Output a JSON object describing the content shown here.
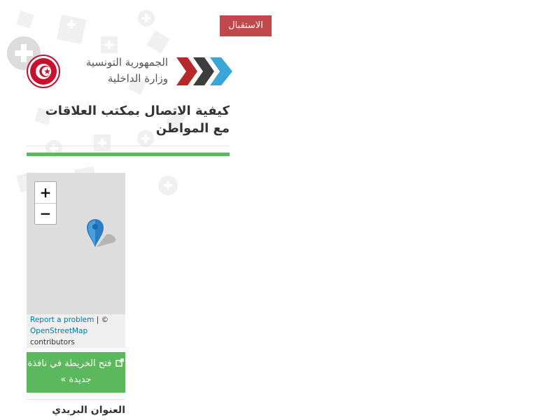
{
  "nav": {
    "home_label": "الاستقبال"
  },
  "header": {
    "ministry_line1": "الجمهورية التونسية",
    "ministry_line2": "وزارة الداخلية",
    "brand_colors": {
      "chevron_red": "#b5282b",
      "chevron_dark": "#3d3d3d",
      "chevron_blue": "#3aa6d8",
      "emblem_red": "#c8102e"
    }
  },
  "page": {
    "title": "كيفية الاتصال بمكتب العلاقات مع المواطن",
    "accent_color": "#5cb85c"
  },
  "map": {
    "zoom_in_label": "+",
    "zoom_out_label": "−",
    "marker_icon": "map-marker-icon",
    "attribution": {
      "report_link": "Report a problem",
      "separator": " | © ",
      "osm_link": "OpenStreetMap",
      "contributors": "contributors"
    }
  },
  "open_map_button": {
    "label": "فتح الخريطة في نافذة جديدة »",
    "icon": "external-link-icon"
  },
  "address": {
    "heading": "العنوان البريدي"
  }
}
